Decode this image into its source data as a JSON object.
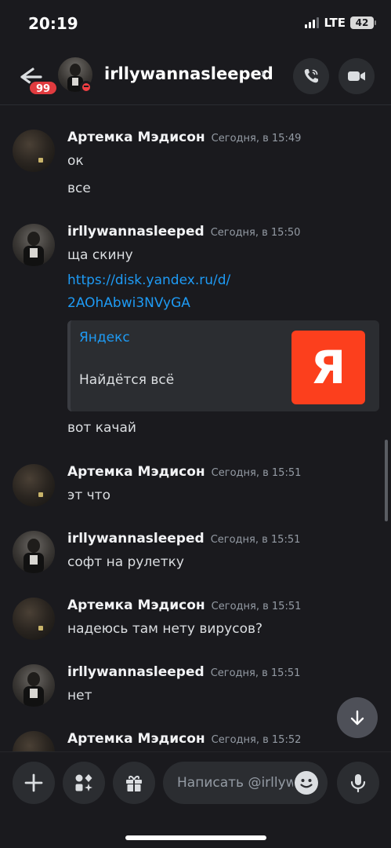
{
  "status_bar": {
    "time": "20:19",
    "network": "LTE",
    "battery": "42"
  },
  "header": {
    "unread_count": "99",
    "title": "irllywannasleeped",
    "chevron": "›",
    "icons": {
      "back": "arrow-left-icon",
      "call": "phone-icon",
      "video": "video-camera-icon"
    }
  },
  "messages": [
    {
      "author": "Артемка Мэдисон",
      "timestamp": "Сегодня, в 15:49",
      "lines": [
        "ок",
        "все"
      ]
    },
    {
      "author": "irllywannasleeped",
      "timestamp": "Сегодня, в 15:50",
      "lines": [
        "ща скину"
      ],
      "link_lines": [
        "https://disk.yandex.ru/d/",
        "2AOhAbwi3NVyGA"
      ],
      "embed": {
        "provider": "Яндекс",
        "description": "Найдётся всё",
        "thumb_letter": "Я"
      },
      "after_lines": [
        "вот качай"
      ]
    },
    {
      "author": "Артемка Мэдисон",
      "timestamp": "Сегодня, в 15:51",
      "lines": [
        "эт что"
      ]
    },
    {
      "author": "irllywannasleeped",
      "timestamp": "Сегодня, в 15:51",
      "lines": [
        "софт на рулетку"
      ]
    },
    {
      "author": "Артемка Мэдисон",
      "timestamp": "Сегодня, в 15:51",
      "lines": [
        "надеюсь там нету вирусов?"
      ]
    },
    {
      "author": "irllywannasleeped",
      "timestamp": "Сегодня, в 15:51",
      "lines": [
        "нет"
      ]
    },
    {
      "author": "Артемка Мэдисон",
      "timestamp": "Сегодня, в 15:52",
      "lines": []
    }
  ],
  "composer": {
    "placeholder": "Написать @irllywannasleeped",
    "icons": {
      "add": "plus-icon",
      "apps": "apps-icon",
      "gift": "gift-icon",
      "emoji": "emoji-icon",
      "voice": "microphone-icon",
      "jump": "arrow-down-icon"
    }
  },
  "colors": {
    "background": "#1a1a1e",
    "link": "#1e9bf5",
    "badge": "#e03b3f",
    "yandex": "#fc3f1d"
  }
}
